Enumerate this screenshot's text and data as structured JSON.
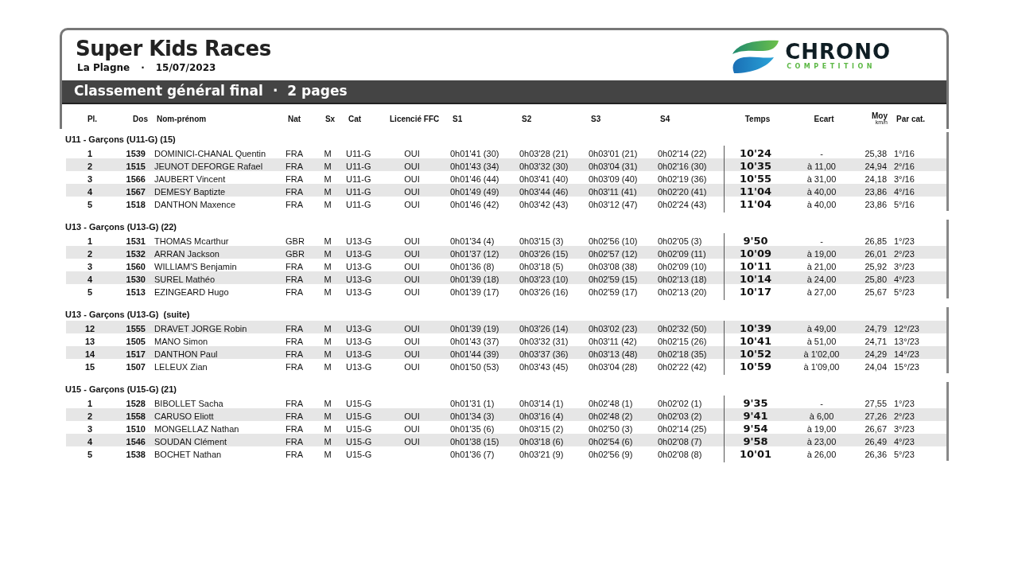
{
  "header": {
    "title": "Super Kids Races",
    "location": "La Plagne",
    "separator": "·",
    "date": "15/07/2023",
    "logo": {
      "name": "CHRONO",
      "tagline": "COMPETITION"
    }
  },
  "banner": {
    "title": "Classement général final",
    "separator": "·",
    "pages": "2 pages"
  },
  "columns": {
    "pl": "Pl.",
    "dos": "Dos",
    "name": "Nom-prénom",
    "nat": "Nat",
    "sx": "Sx",
    "cat": "Cat",
    "lic": "Licencié FFC",
    "s1": "S1",
    "s2": "S2",
    "s3": "S3",
    "s4": "S4",
    "temps": "Temps",
    "ecart": "Ecart",
    "moy": "Moy",
    "moy_unit": "km/h",
    "par": "Par cat."
  },
  "groups": [
    {
      "title": "U11 - Garçons (U11-G) (15)",
      "rows": [
        {
          "pl": "1",
          "dos": "1539",
          "name": "DOMINICI-CHANAL Quentin",
          "nat": "FRA",
          "sx": "M",
          "cat": "U11-G",
          "lic": "OUI",
          "s1": "0h01'41 (30)",
          "s2": "0h03'28 (21)",
          "s3": "0h03'01 (21)",
          "s4": "0h02'14 (22)",
          "temps": "10'24",
          "ecart": "-",
          "moy": "25,38",
          "par": "1°/16",
          "shaded": false
        },
        {
          "pl": "2",
          "dos": "1515",
          "name": "JEUNOT DEFORGE Rafael",
          "nat": "FRA",
          "sx": "M",
          "cat": "U11-G",
          "lic": "OUI",
          "s1": "0h01'43 (34)",
          "s2": "0h03'32 (30)",
          "s3": "0h03'04 (31)",
          "s4": "0h02'16 (30)",
          "temps": "10'35",
          "ecart": "à 11,00",
          "moy": "24,94",
          "par": "2°/16",
          "shaded": true
        },
        {
          "pl": "3",
          "dos": "1566",
          "name": "JAUBERT Vincent",
          "nat": "FRA",
          "sx": "M",
          "cat": "U11-G",
          "lic": "OUI",
          "s1": "0h01'46 (44)",
          "s2": "0h03'41 (40)",
          "s3": "0h03'09 (40)",
          "s4": "0h02'19 (36)",
          "temps": "10'55",
          "ecart": "à 31,00",
          "moy": "24,18",
          "par": "3°/16",
          "shaded": false
        },
        {
          "pl": "4",
          "dos": "1567",
          "name": "DEMESY Baptizte",
          "nat": "FRA",
          "sx": "M",
          "cat": "U11-G",
          "lic": "OUI",
          "s1": "0h01'49 (49)",
          "s2": "0h03'44 (46)",
          "s3": "0h03'11 (41)",
          "s4": "0h02'20 (41)",
          "temps": "11'04",
          "ecart": "à 40,00",
          "moy": "23,86",
          "par": "4°/16",
          "shaded": true
        },
        {
          "pl": "5",
          "dos": "1518",
          "name": "DANTHON Maxence",
          "nat": "FRA",
          "sx": "M",
          "cat": "U11-G",
          "lic": "OUI",
          "s1": "0h01'46 (42)",
          "s2": "0h03'42 (43)",
          "s3": "0h03'12 (47)",
          "s4": "0h02'24 (43)",
          "temps": "11'04",
          "ecart": "à 40,00",
          "moy": "23,86",
          "par": "5°/16",
          "shaded": false
        }
      ]
    },
    {
      "title": "U13 - Garçons (U13-G) (22)",
      "rows": [
        {
          "pl": "1",
          "dos": "1531",
          "name": "THOMAS Mcarthur",
          "nat": "GBR",
          "sx": "M",
          "cat": "U13-G",
          "lic": "OUI",
          "s1": "0h01'34 (4)",
          "s2": "0h03'15 (3)",
          "s3": "0h02'56 (10)",
          "s4": "0h02'05 (3)",
          "temps": "9'50",
          "ecart": "-",
          "moy": "26,85",
          "par": "1°/23",
          "shaded": false
        },
        {
          "pl": "2",
          "dos": "1532",
          "name": "ARRAN Jackson",
          "nat": "GBR",
          "sx": "M",
          "cat": "U13-G",
          "lic": "OUI",
          "s1": "0h01'37 (12)",
          "s2": "0h03'26 (15)",
          "s3": "0h02'57 (12)",
          "s4": "0h02'09 (11)",
          "temps": "10'09",
          "ecart": "à 19,00",
          "moy": "26,01",
          "par": "2°/23",
          "shaded": true
        },
        {
          "pl": "3",
          "dos": "1560",
          "name": "WILLIAM'S Benjamin",
          "nat": "FRA",
          "sx": "M",
          "cat": "U13-G",
          "lic": "OUI",
          "s1": "0h01'36 (8)",
          "s2": "0h03'18 (5)",
          "s3": "0h03'08 (38)",
          "s4": "0h02'09 (10)",
          "temps": "10'11",
          "ecart": "à 21,00",
          "moy": "25,92",
          "par": "3°/23",
          "shaded": false
        },
        {
          "pl": "4",
          "dos": "1530",
          "name": "SUREL Mathéo",
          "nat": "FRA",
          "sx": "M",
          "cat": "U13-G",
          "lic": "OUI",
          "s1": "0h01'39 (18)",
          "s2": "0h03'23 (10)",
          "s3": "0h02'59 (15)",
          "s4": "0h02'13 (18)",
          "temps": "10'14",
          "ecart": "à 24,00",
          "moy": "25,80",
          "par": "4°/23",
          "shaded": true
        },
        {
          "pl": "5",
          "dos": "1513",
          "name": "EZINGEARD Hugo",
          "nat": "FRA",
          "sx": "M",
          "cat": "U13-G",
          "lic": "OUI",
          "s1": "0h01'39 (17)",
          "s2": "0h03'26 (16)",
          "s3": "0h02'59 (17)",
          "s4": "0h02'13 (20)",
          "temps": "10'17",
          "ecart": "à 27,00",
          "moy": "25,67",
          "par": "5°/23",
          "shaded": false
        }
      ]
    },
    {
      "title": "U13 - Garçons (U13-G)  (suite)",
      "rows": [
        {
          "pl": "12",
          "dos": "1555",
          "name": "DRAVET JORGE Robin",
          "nat": "FRA",
          "sx": "M",
          "cat": "U13-G",
          "lic": "OUI",
          "s1": "0h01'39 (19)",
          "s2": "0h03'26 (14)",
          "s3": "0h03'02 (23)",
          "s4": "0h02'32 (50)",
          "temps": "10'39",
          "ecart": "à 49,00",
          "moy": "24,79",
          "par": "12°/23",
          "shaded": true
        },
        {
          "pl": "13",
          "dos": "1505",
          "name": "MANO Simon",
          "nat": "FRA",
          "sx": "M",
          "cat": "U13-G",
          "lic": "OUI",
          "s1": "0h01'43 (37)",
          "s2": "0h03'32 (31)",
          "s3": "0h03'11 (42)",
          "s4": "0h02'15 (26)",
          "temps": "10'41",
          "ecart": "à 51,00",
          "moy": "24,71",
          "par": "13°/23",
          "shaded": false
        },
        {
          "pl": "14",
          "dos": "1517",
          "name": "DANTHON Paul",
          "nat": "FRA",
          "sx": "M",
          "cat": "U13-G",
          "lic": "OUI",
          "s1": "0h01'44 (39)",
          "s2": "0h03'37 (36)",
          "s3": "0h03'13 (48)",
          "s4": "0h02'18 (35)",
          "temps": "10'52",
          "ecart": "à 1'02,00",
          "moy": "24,29",
          "par": "14°/23",
          "shaded": true
        },
        {
          "pl": "15",
          "dos": "1507",
          "name": "LELEUX Zian",
          "nat": "FRA",
          "sx": "M",
          "cat": "U13-G",
          "lic": "OUI",
          "s1": "0h01'50 (53)",
          "s2": "0h03'43 (45)",
          "s3": "0h03'04 (28)",
          "s4": "0h02'22 (42)",
          "temps": "10'59",
          "ecart": "à 1'09,00",
          "moy": "24,04",
          "par": "15°/23",
          "shaded": false
        }
      ]
    },
    {
      "title": "U15 - Garçons (U15-G) (21)",
      "rows": [
        {
          "pl": "1",
          "dos": "1528",
          "name": "BIBOLLET Sacha",
          "nat": "FRA",
          "sx": "M",
          "cat": "U15-G",
          "lic": "",
          "s1": "0h01'31 (1)",
          "s2": "0h03'14 (1)",
          "s3": "0h02'48 (1)",
          "s4": "0h02'02 (1)",
          "temps": "9'35",
          "ecart": "-",
          "moy": "27,55",
          "par": "1°/23",
          "shaded": false
        },
        {
          "pl": "2",
          "dos": "1558",
          "name": "CARUSO Eliott",
          "nat": "FRA",
          "sx": "M",
          "cat": "U15-G",
          "lic": "OUI",
          "s1": "0h01'34 (3)",
          "s2": "0h03'16 (4)",
          "s3": "0h02'48 (2)",
          "s4": "0h02'03 (2)",
          "temps": "9'41",
          "ecart": "à 6,00",
          "moy": "27,26",
          "par": "2°/23",
          "shaded": true
        },
        {
          "pl": "3",
          "dos": "1510",
          "name": "MONGELLAZ Nathan",
          "nat": "FRA",
          "sx": "M",
          "cat": "U15-G",
          "lic": "OUI",
          "s1": "0h01'35 (6)",
          "s2": "0h03'15 (2)",
          "s3": "0h02'50 (3)",
          "s4": "0h02'14 (25)",
          "temps": "9'54",
          "ecart": "à 19,00",
          "moy": "26,67",
          "par": "3°/23",
          "shaded": false
        },
        {
          "pl": "4",
          "dos": "1546",
          "name": "SOUDAN Clément",
          "nat": "FRA",
          "sx": "M",
          "cat": "U15-G",
          "lic": "OUI",
          "s1": "0h01'38 (15)",
          "s2": "0h03'18 (6)",
          "s3": "0h02'54 (6)",
          "s4": "0h02'08 (7)",
          "temps": "9'58",
          "ecart": "à 23,00",
          "moy": "26,49",
          "par": "4°/23",
          "shaded": true
        },
        {
          "pl": "5",
          "dos": "1538",
          "name": "BOCHET Nathan",
          "nat": "FRA",
          "sx": "M",
          "cat": "U15-G",
          "lic": "",
          "s1": "0h01'36 (7)",
          "s2": "0h03'21 (9)",
          "s3": "0h02'56 (9)",
          "s4": "0h02'08 (8)",
          "temps": "10'01",
          "ecart": "à 26,00",
          "moy": "26,36",
          "par": "5°/23",
          "shaded": false
        }
      ]
    }
  ]
}
